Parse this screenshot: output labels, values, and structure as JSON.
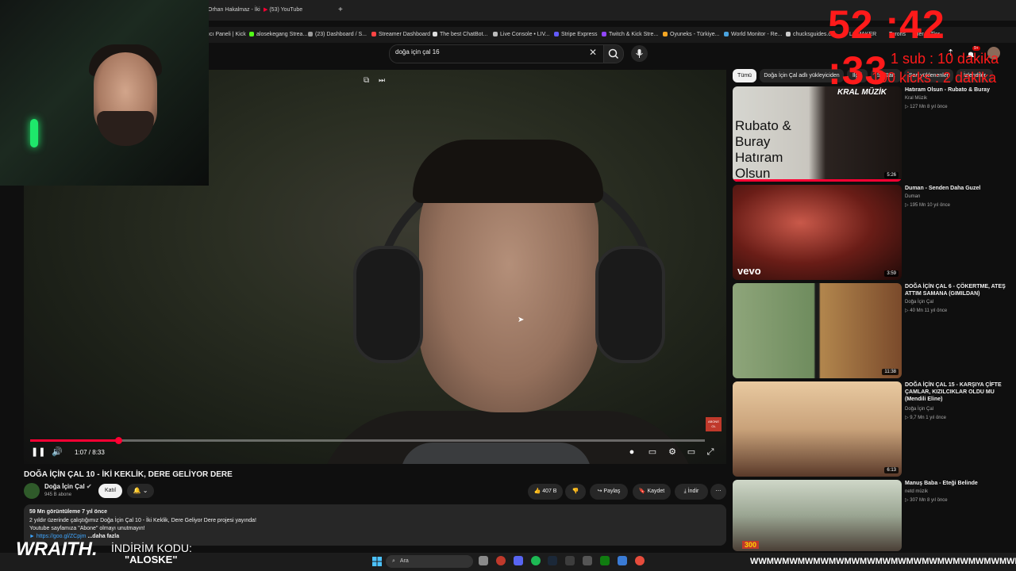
{
  "browser": {
    "tabs": [
      "Orhan Hakalmaz - İki",
      "(53) YouTube"
    ],
    "bookmarks": [
      "ıcı Paneli | Kick",
      "alosekegang Strea...",
      "(23) Dashboard / S...",
      "Streamer Dashboard",
      "The best ChatBot...",
      "Live Console • LIV...",
      "Stripe Express",
      "Twitch & Kick Stre...",
      "Oyuneks - Türkiye...",
      "World Monitor - Re...",
      "chucksguides.c...",
      "LOMAKER",
      "Terons",
      "aler",
      "Tler"
    ]
  },
  "search": {
    "query": "doğa için çal 16"
  },
  "player": {
    "time": "1:07 / 8:33",
    "progress_fraction": 0.131,
    "badge": "ABONE OL"
  },
  "video": {
    "title": "DOĞA İÇİN ÇAL 10 - İKİ KEKLİK, DERE GELİYOR DERE",
    "channel": "Doğa İçin Çal",
    "subscribers": "945 B abone",
    "join_label": "Katıl",
    "likes": "407 B",
    "share_label": "Paylaş",
    "save_label": "Kaydet",
    "download_label": "İndir",
    "description": {
      "stats": "59 Mn görüntüleme  7 yıl önce",
      "line1": "2 yıldır üzerinde çalıştığımız Doğa İçin Çal 10 - İki Keklik, Dere Geliyor Dere projesi yayında!",
      "line2": "Youtube sayfamıza \"Abone\" olmayı unutmayın!",
      "link": "► https://goo.gl/ZCpjm",
      "more": "...daha fazla"
    }
  },
  "chips": [
    "Tümü",
    "Doğa İçin Çal adlı yükleyiciden",
    "İlgili",
    "Su Sait",
    "Son yüklenenler",
    "İzlendiler"
  ],
  "recommendations": [
    {
      "title": "Hatıram Olsun - Rubato & Buray",
      "channel": "Kral Müzik",
      "meta": "▷ 127 Mn   8 yıl önce",
      "duration": "5:26",
      "thumb_text": "Rubato & Buray Hatıram Olsun",
      "brand": "KRAL MÜZİK"
    },
    {
      "title": "Duman - Senden Daha Guzel",
      "channel": "Duman",
      "meta": "▷ 195 Mn   10 yıl önce",
      "duration": "3:59",
      "thumb_text": "vevo",
      "brand": ""
    },
    {
      "title": "DOĞA İÇİN ÇAL 6 - ÇÖKERTME, ATEŞ ATTIM SAMANA (GIMILDAN)",
      "channel": "Doğa İçin Çal",
      "meta": "▷ 40 Mn   11 yıl önce",
      "duration": "11:38",
      "thumb_text": "",
      "brand": ""
    },
    {
      "title": "DOĞA İÇİN ÇAL 15 - KARŞIYA ÇİFTE ÇAMLAR, KIZILCIKLAR OLDU MU (Mendili Eline)",
      "channel": "Doğa İçin Çal",
      "meta": "▷ 9,7 Mn   1 yıl önce",
      "duration": "6:13",
      "thumb_text": "",
      "brand": ""
    },
    {
      "title": "Manuş Baba - Eteği Belinde",
      "channel": "netd müzik",
      "meta": "▷ 307 Mn   8 yıl önce",
      "duration": "",
      "thumb_text": "300",
      "brand": ""
    }
  ],
  "overlay": {
    "timer": "52 :42 :33",
    "line1": "1 sub : 10 dakika",
    "line2": "100 kicks : 2 dakika",
    "sponsor": "WRAITH.",
    "promo_label": "İNDİRİM KODU:",
    "promo_code": "\"ALOSKE\"",
    "ticker": "WWMWMWMWMWMWMWMWMWMWMWMWMWMWMWMWMWMWW"
  },
  "taskbar": {
    "search_placeholder": "Ara"
  },
  "colors": {
    "accent": "#ff0033",
    "overlay_red": "#ff1a1a",
    "background": "#0f0f0f"
  }
}
